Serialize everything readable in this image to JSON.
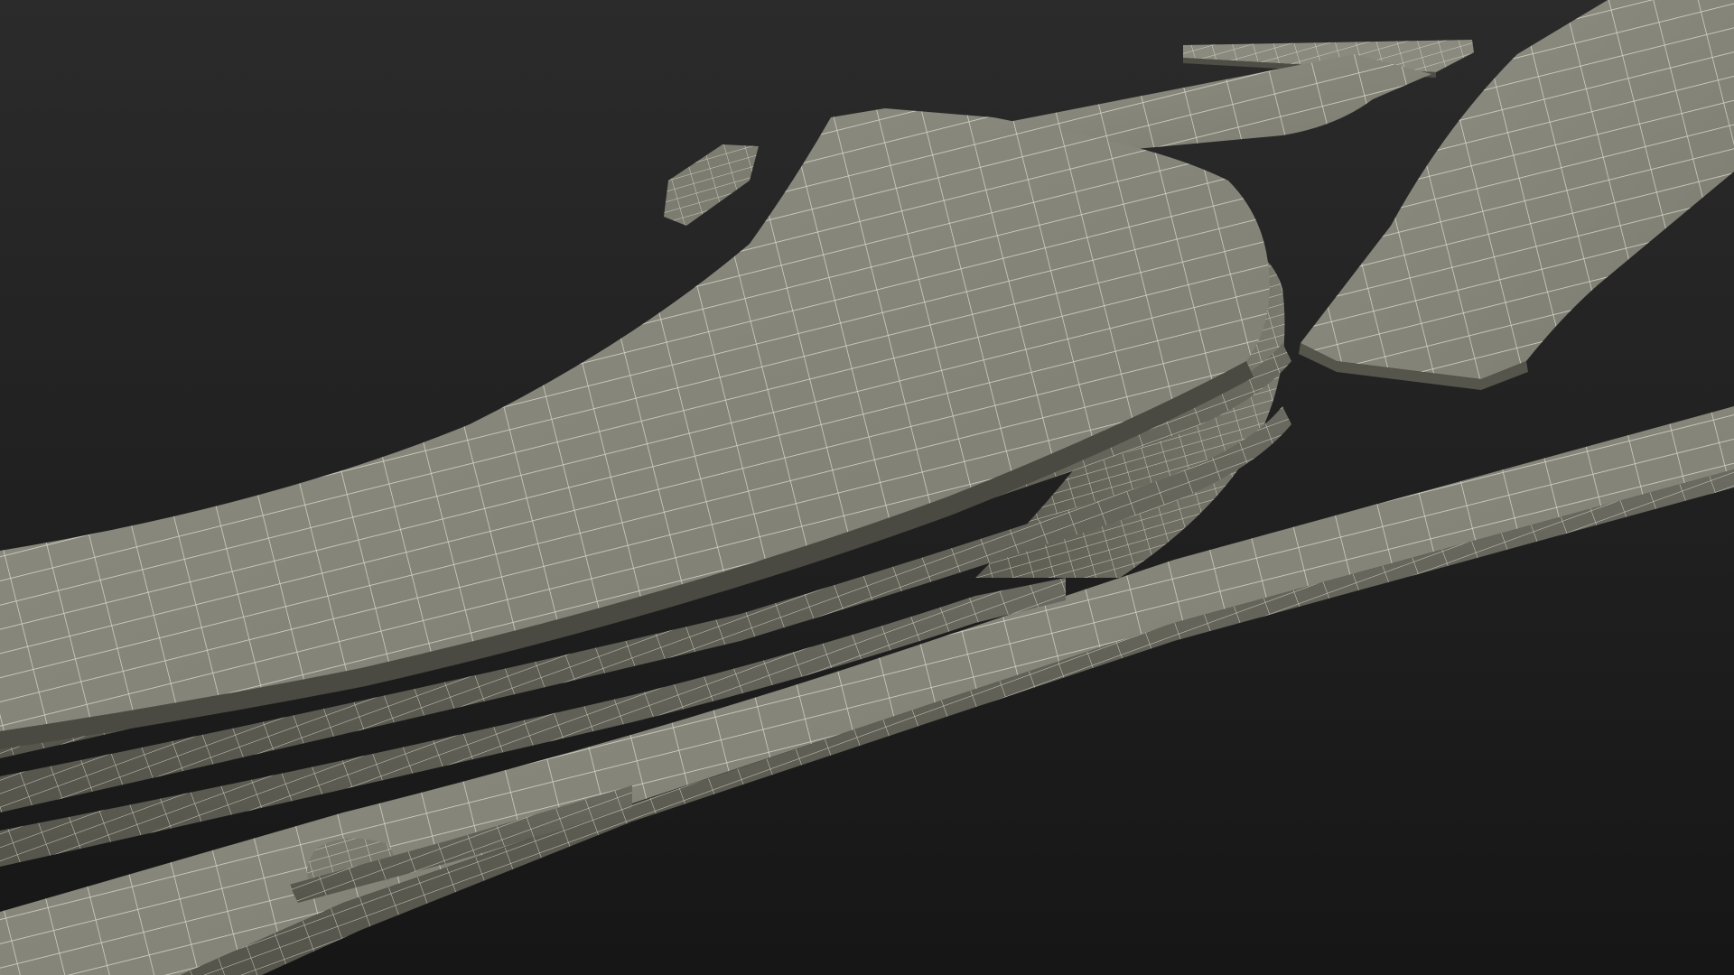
{
  "scene": {
    "subject": "leaf-spring-wireframe-render",
    "colors": {
      "background_top": "#2b2b2b",
      "background_bottom": "#161616",
      "surface_light": "#8c8c80",
      "surface_mid": "#7a7a6e",
      "surface_dark": "#5e5e54",
      "edge_shadow": "#3e3e36",
      "wire": "#e8e8dc"
    },
    "leaf_count": 6
  }
}
